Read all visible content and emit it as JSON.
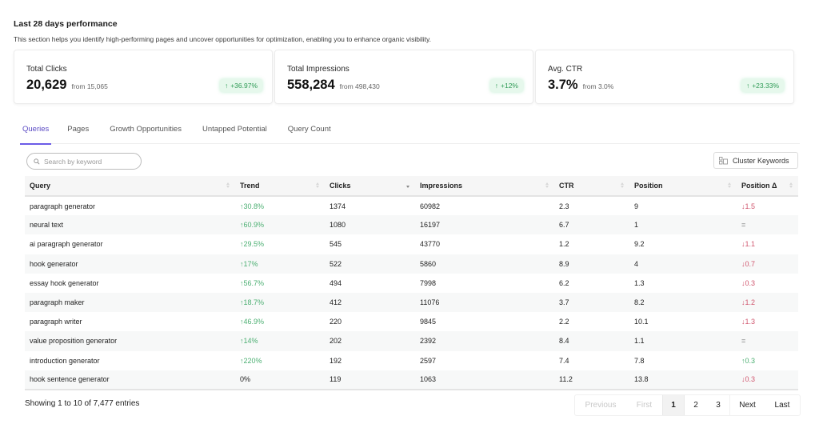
{
  "header": {
    "title": "Last 28 days performance",
    "subtitle": "This section helps you identify high-performing pages and uncover opportunities for optimization, enabling you to enhance organic visibility."
  },
  "cards": [
    {
      "label": "Total Clicks",
      "value": "20,629",
      "from": "from 15,065",
      "change": "+36.97%",
      "direction": "up"
    },
    {
      "label": "Total Impressions",
      "value": "558,284",
      "from": "from 498,430",
      "change": "+12%",
      "direction": "up"
    },
    {
      "label": "Avg. CTR",
      "value": "3.7%",
      "from": "from 3.0%",
      "change": "+23.33%",
      "direction": "up"
    }
  ],
  "tabs": [
    {
      "label": "Queries",
      "active": true
    },
    {
      "label": "Pages",
      "active": false
    },
    {
      "label": "Growth Opportunities",
      "active": false
    },
    {
      "label": "Untapped Potential",
      "active": false
    },
    {
      "label": "Query Count",
      "active": false
    }
  ],
  "search": {
    "placeholder": "Search by keyword",
    "value": ""
  },
  "toolbar": {
    "cluster_label": "Cluster Keywords"
  },
  "table": {
    "columns": [
      "Query",
      "Trend",
      "Clicks",
      "Impressions",
      "CTR",
      "Position",
      "Position Δ"
    ],
    "sorted_column": "Clicks",
    "sort_direction": "desc",
    "rows": [
      {
        "query": "paragraph generator",
        "trend": "↑30.8%",
        "trend_dir": "up",
        "clicks": "1374",
        "impressions": "60982",
        "ctr": "2.3",
        "position": "9",
        "pos_delta": "↓1.5",
        "pos_dir": "down"
      },
      {
        "query": "neural text",
        "trend": "↑60.9%",
        "trend_dir": "up",
        "clicks": "1080",
        "impressions": "16197",
        "ctr": "6.7",
        "position": "1",
        "pos_delta": "=",
        "pos_dir": "neutral"
      },
      {
        "query": "ai paragraph generator",
        "trend": "↑29.5%",
        "trend_dir": "up",
        "clicks": "545",
        "impressions": "43770",
        "ctr": "1.2",
        "position": "9.2",
        "pos_delta": "↓1.1",
        "pos_dir": "down"
      },
      {
        "query": "hook generator",
        "trend": "↑17%",
        "trend_dir": "up",
        "clicks": "522",
        "impressions": "5860",
        "ctr": "8.9",
        "position": "4",
        "pos_delta": "↓0.7",
        "pos_dir": "down"
      },
      {
        "query": "essay hook generator",
        "trend": "↑56.7%",
        "trend_dir": "up",
        "clicks": "494",
        "impressions": "7998",
        "ctr": "6.2",
        "position": "1.3",
        "pos_delta": "↓0.3",
        "pos_dir": "down"
      },
      {
        "query": "paragraph maker",
        "trend": "↑18.7%",
        "trend_dir": "up",
        "clicks": "412",
        "impressions": "11076",
        "ctr": "3.7",
        "position": "8.2",
        "pos_delta": "↓1.2",
        "pos_dir": "down"
      },
      {
        "query": "paragraph writer",
        "trend": "↑46.9%",
        "trend_dir": "up",
        "clicks": "220",
        "impressions": "9845",
        "ctr": "2.2",
        "position": "10.1",
        "pos_delta": "↓1.3",
        "pos_dir": "down"
      },
      {
        "query": "value proposition generator",
        "trend": "↑14%",
        "trend_dir": "up",
        "clicks": "202",
        "impressions": "2392",
        "ctr": "8.4",
        "position": "1.1",
        "pos_delta": "=",
        "pos_dir": "neutral"
      },
      {
        "query": "introduction generator",
        "trend": "↑220%",
        "trend_dir": "up",
        "clicks": "192",
        "impressions": "2597",
        "ctr": "7.4",
        "position": "7.8",
        "pos_delta": "↑0.3",
        "pos_dir": "up"
      },
      {
        "query": "hook sentence generator",
        "trend": "0%",
        "trend_dir": "neutral-dark",
        "clicks": "119",
        "impressions": "1063",
        "ctr": "11.2",
        "position": "13.8",
        "pos_delta": "↓0.3",
        "pos_dir": "down"
      }
    ]
  },
  "footer": {
    "showing": "Showing 1 to 10 of 7,477 entries",
    "pagination": [
      {
        "label": "Previous",
        "state": "disabled"
      },
      {
        "label": "First",
        "state": "disabled"
      },
      {
        "label": "1",
        "state": "current"
      },
      {
        "label": "2",
        "state": "normal"
      },
      {
        "label": "3",
        "state": "normal"
      },
      {
        "label": "Next",
        "state": "normal"
      },
      {
        "label": "Last",
        "state": "normal"
      }
    ]
  },
  "colors": {
    "accent": "#6c5ce7",
    "positive": "#4caf72",
    "negative": "#d0566e",
    "badge_bg": "#e6f8ec"
  }
}
